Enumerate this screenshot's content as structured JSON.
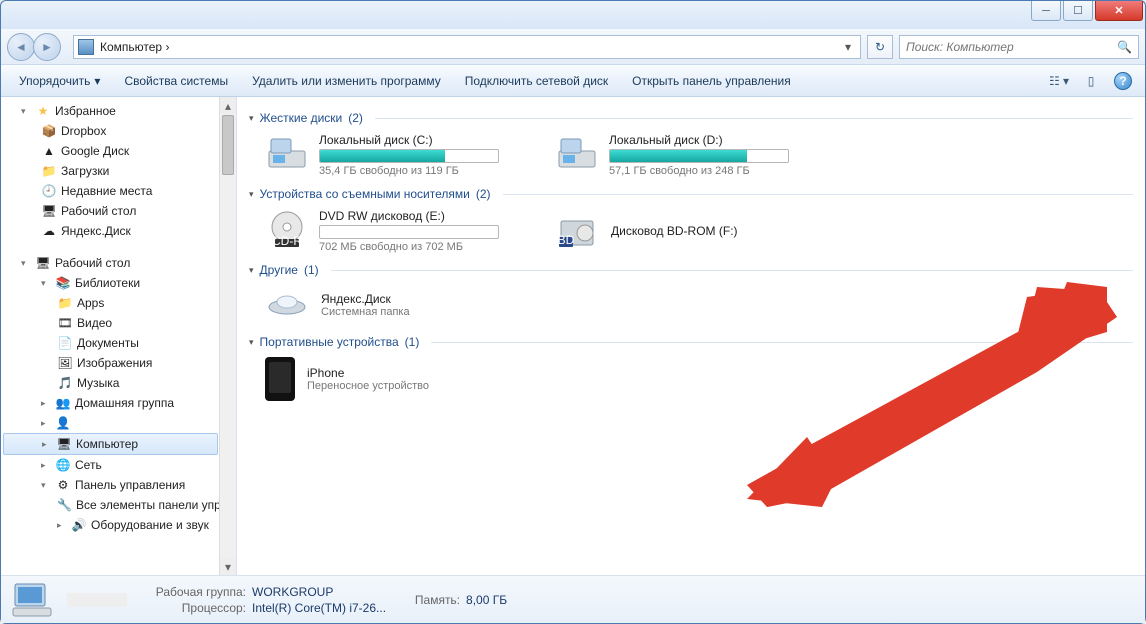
{
  "titlebar": {
    "min": "─",
    "max": "☐",
    "close": "✕"
  },
  "nav": {
    "path_label": "Компьютер",
    "path_sep": "›",
    "refresh": "↻",
    "search_placeholder": "Поиск: Компьютер"
  },
  "toolbar": {
    "organize": "Упорядочить",
    "sys_props": "Свойства системы",
    "uninstall": "Удалить или изменить программу",
    "map_drive": "Подключить сетевой диск",
    "control_panel": "Открыть панель управления"
  },
  "sidebar": {
    "favorites": "Избранное",
    "fav_items": [
      "Dropbox",
      "Google Диск",
      "Загрузки",
      "Недавние места",
      "Рабочий стол",
      "Яндекс.Диск"
    ],
    "desktop": "Рабочий стол",
    "libraries": "Библиотеки",
    "lib_items": [
      "Apps",
      "Видео",
      "Документы",
      "Изображения",
      "Музыка"
    ],
    "homegroup": "Домашняя группа",
    "hidden_user": "",
    "computer": "Компьютер",
    "network": "Сеть",
    "control_panel": "Панель управления",
    "cp_items": [
      "Все элементы панели управле",
      "Оборудование и звук"
    ]
  },
  "content": {
    "sections": {
      "hdd": {
        "title": "Жесткие диски",
        "count": "(2)"
      },
      "removable": {
        "title": "Устройства со съемными носителями",
        "count": "(2)"
      },
      "other": {
        "title": "Другие",
        "count": "(1)"
      },
      "portable": {
        "title": "Портативные устройства",
        "count": "(1)"
      }
    },
    "drives": {
      "c": {
        "name": "Локальный диск (C:)",
        "free": "35,4 ГБ свободно из 119 ГБ",
        "fill_pct": 70
      },
      "d": {
        "name": "Локальный диск (D:)",
        "free": "57,1 ГБ свободно из 248 ГБ",
        "fill_pct": 77
      },
      "e": {
        "name": "DVD RW дисковод (E:)",
        "free": "702 МБ свободно из 702 МБ",
        "fill_pct": 0
      },
      "f": {
        "name": "Дисковод BD-ROM (F:)"
      }
    },
    "other_item": {
      "name": "Яндекс.Диск",
      "sub": "Системная папка"
    },
    "portable_item": {
      "name": "iPhone",
      "sub": "Переносное устройство"
    }
  },
  "status": {
    "workgroup_label": "Рабочая группа:",
    "workgroup": "WORKGROUP",
    "cpu_label": "Процессор:",
    "cpu": "Intel(R) Core(TM) i7-26...",
    "mem_label": "Память:",
    "mem": "8,00 ГБ"
  }
}
